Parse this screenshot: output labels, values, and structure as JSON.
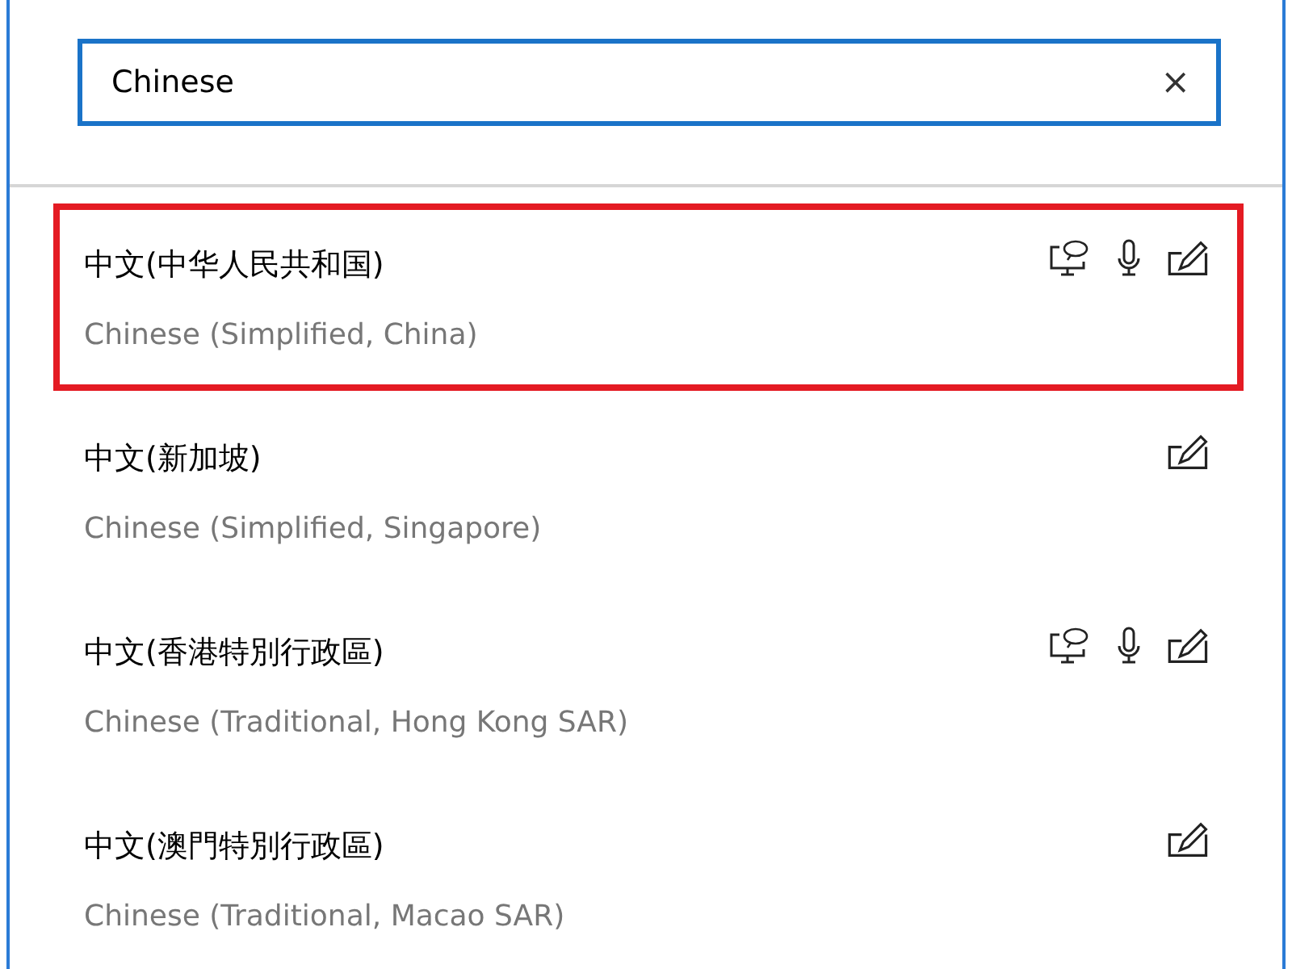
{
  "search": {
    "value": "Chinese",
    "clear": "×"
  },
  "languages": [
    {
      "name": "中文(中华人民共和国)",
      "description": "Chinese (Simplified, China)",
      "highlighted": true,
      "speech": true,
      "voice": true,
      "handwriting": true
    },
    {
      "name": "中文(新加坡)",
      "description": "Chinese (Simplified, Singapore)",
      "highlighted": false,
      "speech": false,
      "voice": false,
      "handwriting": true
    },
    {
      "name": "中文(香港特別行政區)",
      "description": "Chinese (Traditional, Hong Kong SAR)",
      "highlighted": false,
      "speech": true,
      "voice": true,
      "handwriting": true
    },
    {
      "name": "中文(澳門特別行政區)",
      "description": "Chinese (Traditional, Macao SAR)",
      "highlighted": false,
      "speech": false,
      "voice": false,
      "handwriting": true
    }
  ]
}
